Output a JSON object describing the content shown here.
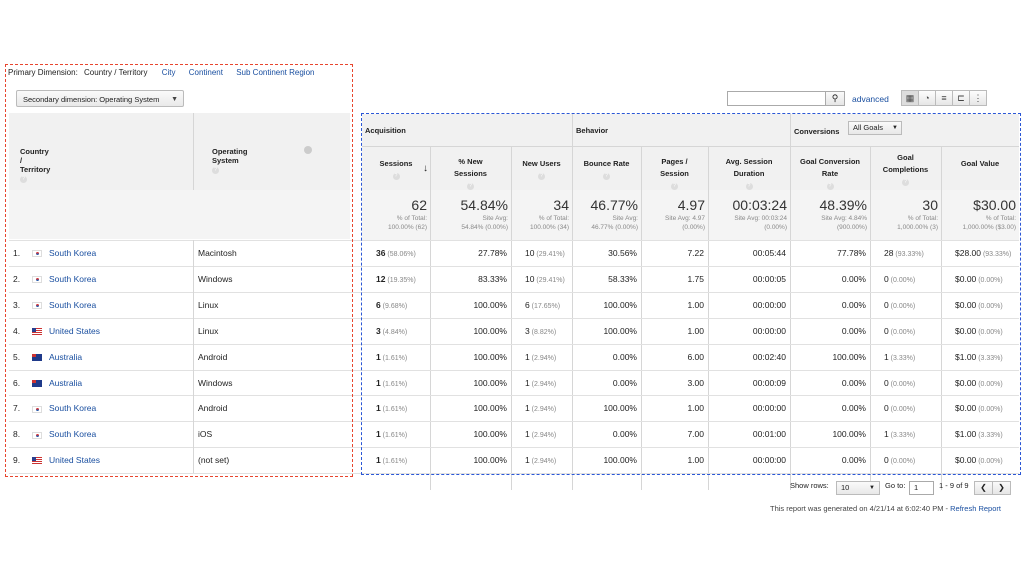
{
  "primary_dimension": {
    "label": "Primary Dimension:",
    "current": "Country / Territory",
    "links": [
      "City",
      "Continent",
      "Sub Continent Region"
    ]
  },
  "secondary_dimension": {
    "label": "Secondary dimension: Operating System"
  },
  "toolbar": {
    "advanced_label": "advanced"
  },
  "headers": {
    "country": "Country / Territory",
    "os": "Operating System",
    "acquisition": "Acquisition",
    "behavior": "Behavior",
    "conversions": "Conversions",
    "goals_select": "All Goals",
    "sessions": "Sessions",
    "new_sessions": [
      "% New",
      "Sessions"
    ],
    "new_users": "New Users",
    "bounce_rate": "Bounce Rate",
    "pages_session": [
      "Pages /",
      "Session"
    ],
    "avg_duration": [
      "Avg. Session",
      "Duration"
    ],
    "conv_rate": [
      "Goal Conversion",
      "Rate"
    ],
    "goal_completions": [
      "Goal",
      "Completions"
    ],
    "goal_value": "Goal Value"
  },
  "totals": [
    {
      "big": "62",
      "l1": "% of Total:",
      "l2": "100.00% (62)"
    },
    {
      "big": "54.84%",
      "l1": "Site Avg:",
      "l2": "54.84% (0.00%)"
    },
    {
      "big": "34",
      "l1": "% of Total:",
      "l2": "100.00% (34)"
    },
    {
      "big": "46.77%",
      "l1": "Site Avg:",
      "l2": "46.77% (0.00%)"
    },
    {
      "big": "4.97",
      "l1": "Site Avg: 4.97",
      "l2": "(0.00%)"
    },
    {
      "big": "00:03:24",
      "l1": "Site Avg: 00:03:24",
      "l2": "(0.00%)"
    },
    {
      "big": "48.39%",
      "l1": "Site Avg: 4.84%",
      "l2": "(900.00%)"
    },
    {
      "big": "30",
      "l1": "% of Total:",
      "l2": "1,000.00% (3)"
    },
    {
      "big": "$30.00",
      "l1": "% of Total:",
      "l2": "1,000.00% ($3.00)"
    }
  ],
  "rows": [
    {
      "num": "1.",
      "country": "South Korea",
      "flag": "kr",
      "os": "Macintosh",
      "sessions": "36",
      "sessions_pct": "(58.06%)",
      "new_sessions": "27.78%",
      "new_users": "10",
      "new_users_pct": "(29.41%)",
      "bounce": "30.56%",
      "pages": "7.22",
      "duration": "00:05:44",
      "conv": "77.78%",
      "goals": "28",
      "goals_pct": "(93.33%)",
      "value": "$28.00",
      "value_pct": "(93.33%)"
    },
    {
      "num": "2.",
      "country": "South Korea",
      "flag": "kr",
      "os": "Windows",
      "sessions": "12",
      "sessions_pct": "(19.35%)",
      "new_sessions": "83.33%",
      "new_users": "10",
      "new_users_pct": "(29.41%)",
      "bounce": "58.33%",
      "pages": "1.75",
      "duration": "00:00:05",
      "conv": "0.00%",
      "goals": "0",
      "goals_pct": "(0.00%)",
      "value": "$0.00",
      "value_pct": "(0.00%)"
    },
    {
      "num": "3.",
      "country": "South Korea",
      "flag": "kr",
      "os": "Linux",
      "sessions": "6",
      "sessions_pct": "(9.68%)",
      "new_sessions": "100.00%",
      "new_users": "6",
      "new_users_pct": "(17.65%)",
      "bounce": "100.00%",
      "pages": "1.00",
      "duration": "00:00:00",
      "conv": "0.00%",
      "goals": "0",
      "goals_pct": "(0.00%)",
      "value": "$0.00",
      "value_pct": "(0.00%)"
    },
    {
      "num": "4.",
      "country": "United States",
      "flag": "us",
      "os": "Linux",
      "sessions": "3",
      "sessions_pct": "(4.84%)",
      "new_sessions": "100.00%",
      "new_users": "3",
      "new_users_pct": "(8.82%)",
      "bounce": "100.00%",
      "pages": "1.00",
      "duration": "00:00:00",
      "conv": "0.00%",
      "goals": "0",
      "goals_pct": "(0.00%)",
      "value": "$0.00",
      "value_pct": "(0.00%)"
    },
    {
      "num": "5.",
      "country": "Australia",
      "flag": "au",
      "os": "Android",
      "sessions": "1",
      "sessions_pct": "(1.61%)",
      "new_sessions": "100.00%",
      "new_users": "1",
      "new_users_pct": "(2.94%)",
      "bounce": "0.00%",
      "pages": "6.00",
      "duration": "00:02:40",
      "conv": "100.00%",
      "goals": "1",
      "goals_pct": "(3.33%)",
      "value": "$1.00",
      "value_pct": "(3.33%)"
    },
    {
      "num": "6.",
      "country": "Australia",
      "flag": "au",
      "os": "Windows",
      "sessions": "1",
      "sessions_pct": "(1.61%)",
      "new_sessions": "100.00%",
      "new_users": "1",
      "new_users_pct": "(2.94%)",
      "bounce": "0.00%",
      "pages": "3.00",
      "duration": "00:00:09",
      "conv": "0.00%",
      "goals": "0",
      "goals_pct": "(0.00%)",
      "value": "$0.00",
      "value_pct": "(0.00%)"
    },
    {
      "num": "7.",
      "country": "South Korea",
      "flag": "kr",
      "os": "Android",
      "sessions": "1",
      "sessions_pct": "(1.61%)",
      "new_sessions": "100.00%",
      "new_users": "1",
      "new_users_pct": "(2.94%)",
      "bounce": "100.00%",
      "pages": "1.00",
      "duration": "00:00:00",
      "conv": "0.00%",
      "goals": "0",
      "goals_pct": "(0.00%)",
      "value": "$0.00",
      "value_pct": "(0.00%)"
    },
    {
      "num": "8.",
      "country": "South Korea",
      "flag": "kr",
      "os": "iOS",
      "sessions": "1",
      "sessions_pct": "(1.61%)",
      "new_sessions": "100.00%",
      "new_users": "1",
      "new_users_pct": "(2.94%)",
      "bounce": "0.00%",
      "pages": "7.00",
      "duration": "00:01:00",
      "conv": "100.00%",
      "goals": "1",
      "goals_pct": "(3.33%)",
      "value": "$1.00",
      "value_pct": "(3.33%)"
    },
    {
      "num": "9.",
      "country": "United States",
      "flag": "us",
      "os": "(not set)",
      "sessions": "1",
      "sessions_pct": "(1.61%)",
      "new_sessions": "100.00%",
      "new_users": "1",
      "new_users_pct": "(2.94%)",
      "bounce": "100.00%",
      "pages": "1.00",
      "duration": "00:00:00",
      "conv": "0.00%",
      "goals": "0",
      "goals_pct": "(0.00%)",
      "value": "$0.00",
      "value_pct": "(0.00%)"
    }
  ],
  "footer": {
    "show_rows_label": "Show rows:",
    "show_rows_value": "10",
    "goto_label": "Go to:",
    "goto_value": "1",
    "range": "1 - 9 of 9",
    "generated": "This report was generated on 4/21/14 at 6:02:40 PM - ",
    "refresh": "Refresh Report"
  },
  "icons": {
    "search": "search-icon",
    "prev": "chevron-left-icon",
    "next": "chevron-right-icon"
  }
}
